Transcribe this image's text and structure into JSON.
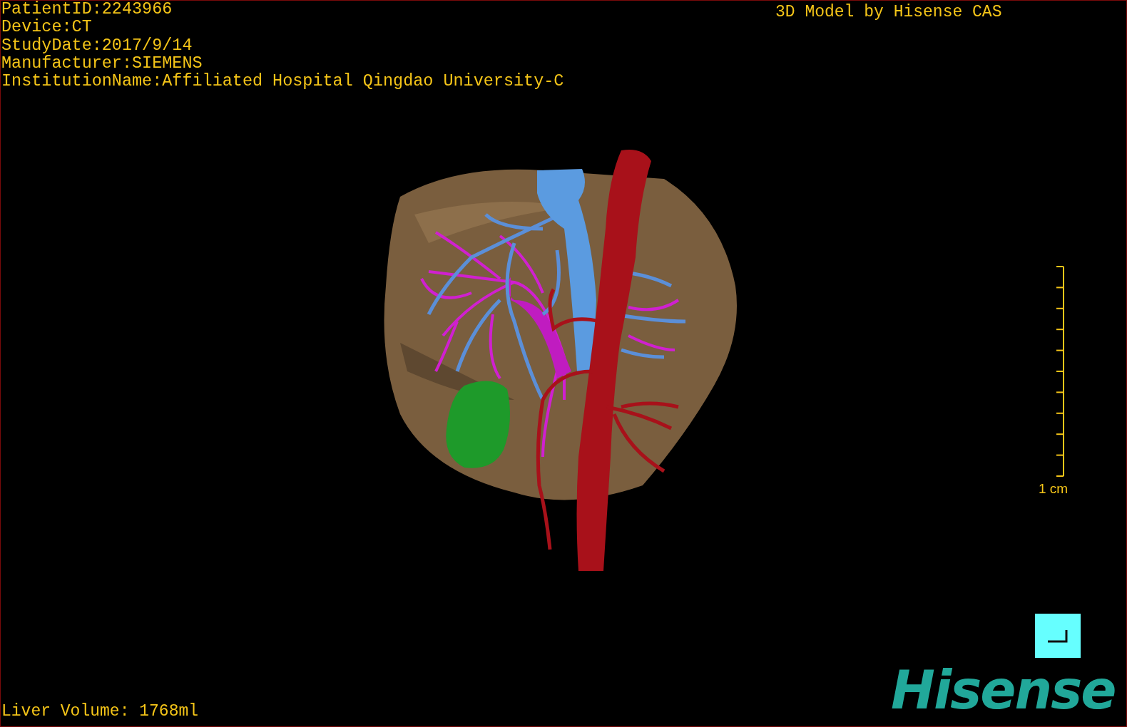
{
  "overlay": {
    "study_info": [
      "PatientID:2243966",
      "Device:CT",
      "StudyDate:2017/9/14",
      "Manufacturer:SIEMENS",
      "InstitutionName:Affiliated Hospital Qingdao University-C"
    ],
    "model_credit": "3D Model by Hisense CAS",
    "liver_volume": "Liver Volume: 1768ml"
  },
  "scale_bar": {
    "label": "1 cm"
  },
  "logo": {
    "text": "Hisense"
  }
}
